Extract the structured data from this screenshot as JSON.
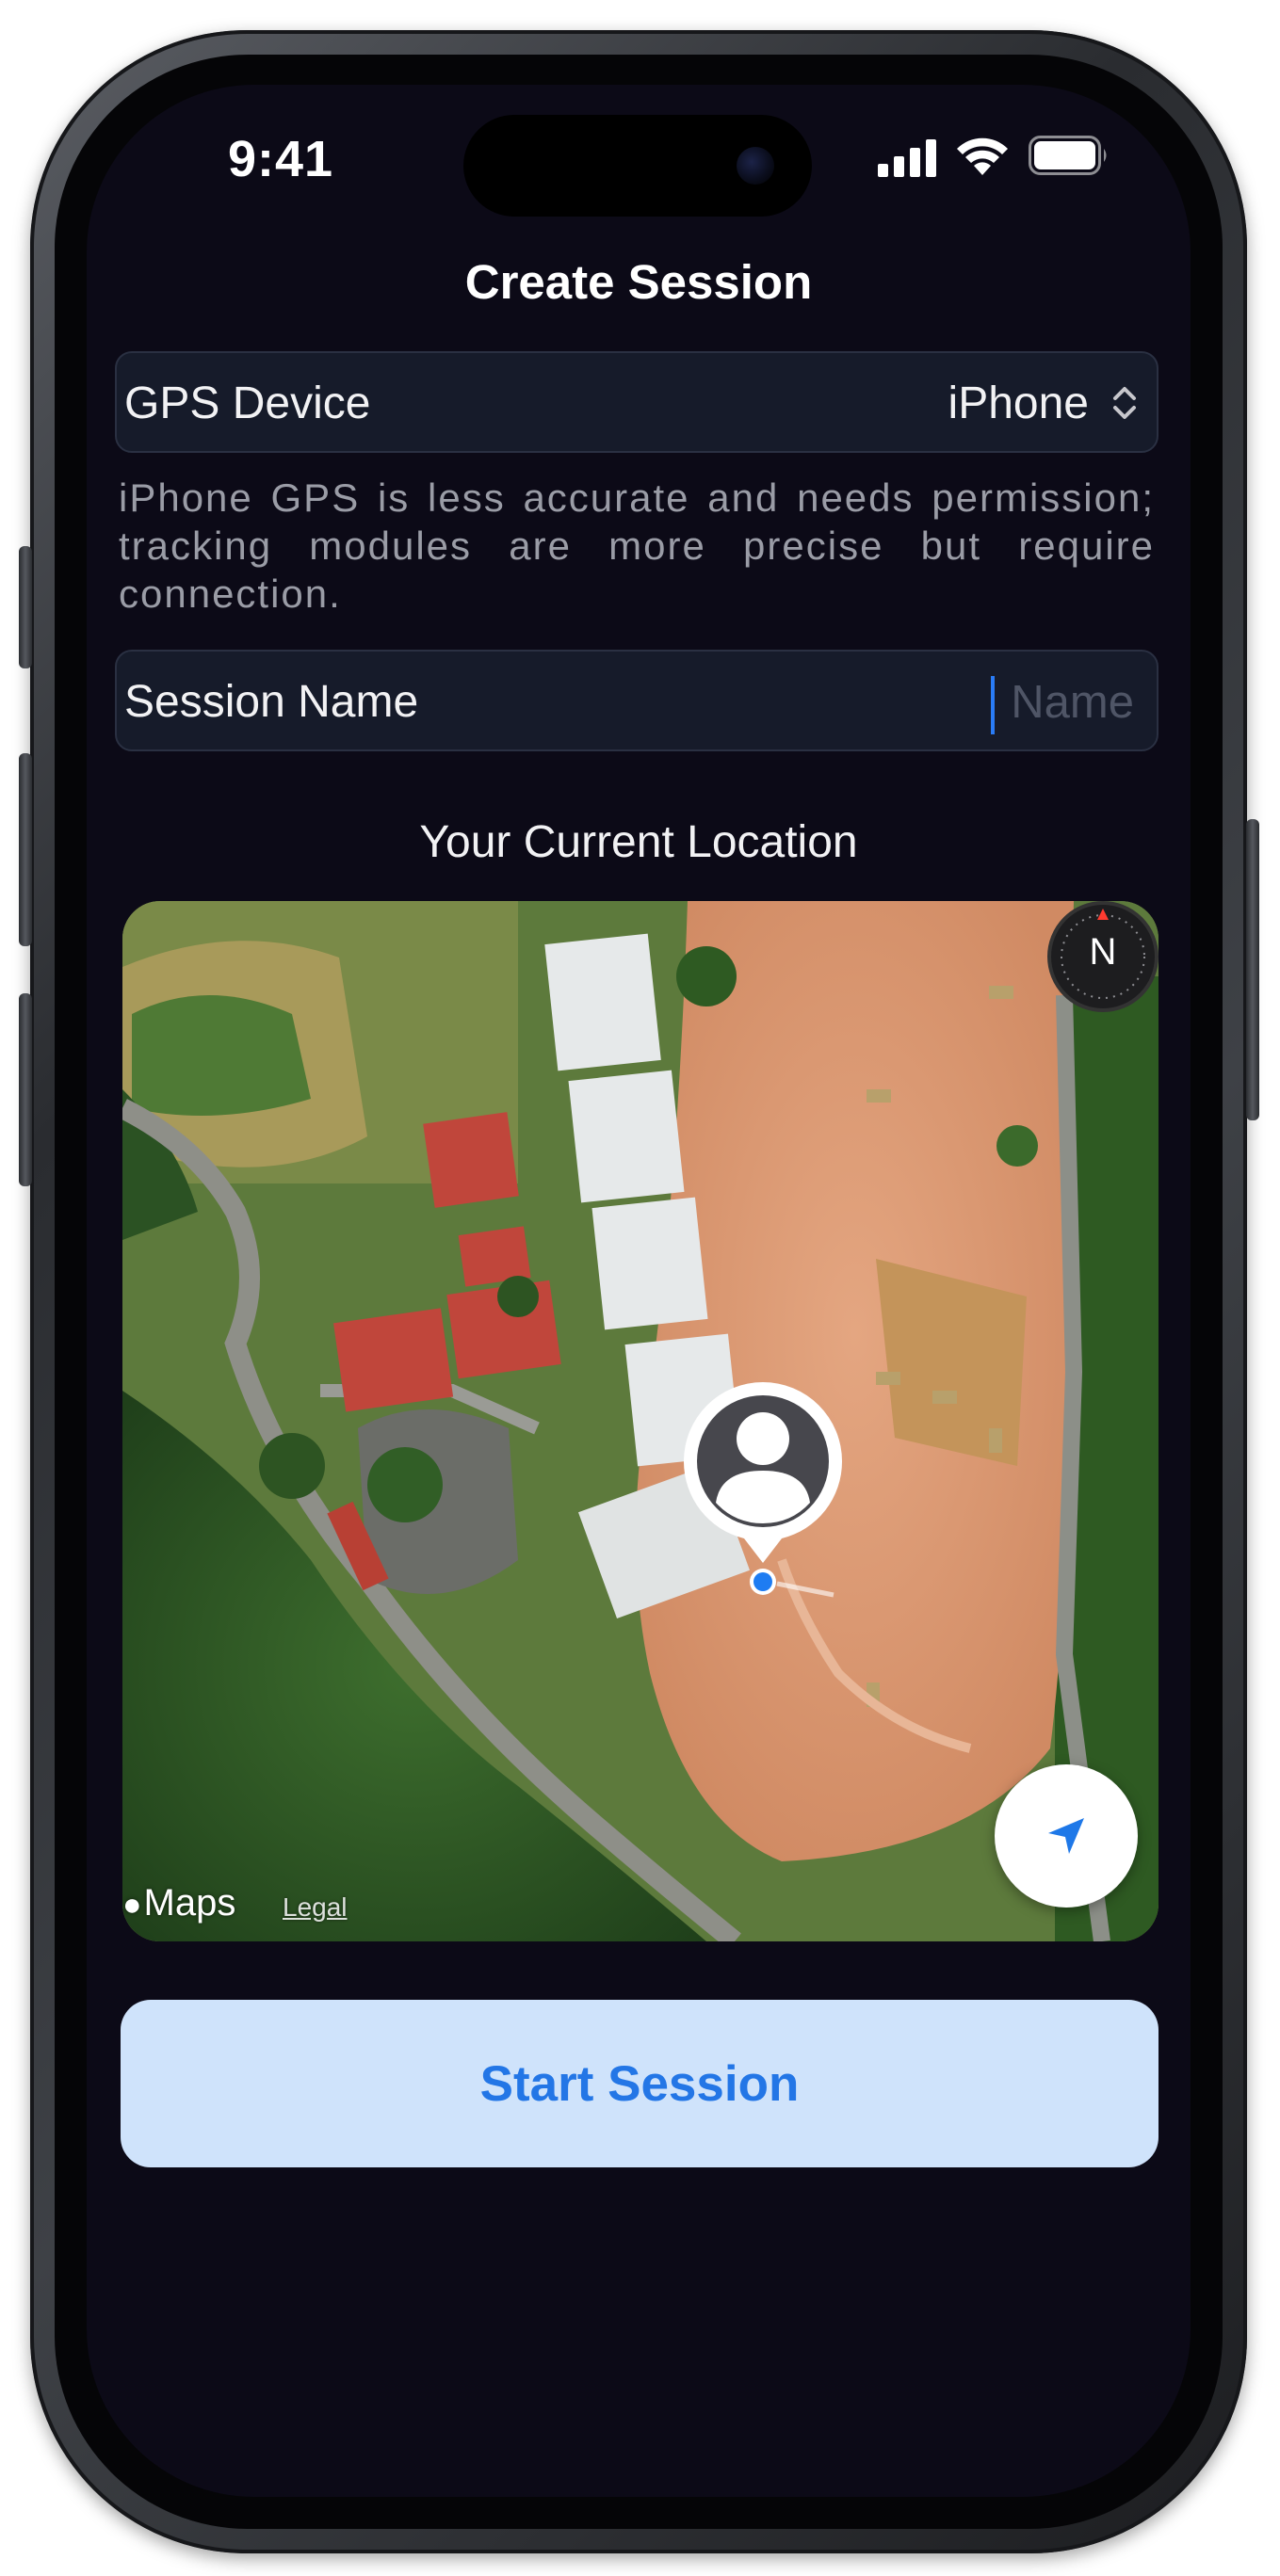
{
  "status_bar": {
    "time": "9:41",
    "icons": [
      "signal-icon",
      "wifi-icon",
      "battery-icon"
    ]
  },
  "header": {
    "title": "Create Session"
  },
  "gps_device": {
    "label": "GPS Device",
    "selected_value": "iPhone",
    "icon": "chevron-up-down-icon"
  },
  "helper_text": "iPhone GPS is less accurate and needs permission; tracking modules are more precise but require connection.",
  "session_name": {
    "label": "Session Name",
    "value": "",
    "placeholder": "Name"
  },
  "location_section": {
    "title": "Your Current Location"
  },
  "map": {
    "compass_label": "N",
    "brand_label": "Maps",
    "legal_label": "Legal",
    "icons": [
      "compass-icon",
      "user-location-pin-icon",
      "location-arrow-icon",
      "apple-logo-icon"
    ]
  },
  "actions": {
    "start_label": "Start Session"
  },
  "colors": {
    "background": "#0c0a17",
    "row_background": "#161b2a",
    "accent": "#2376e6",
    "button_background": "#cfe3fb",
    "caret": "#2a7cf6"
  }
}
